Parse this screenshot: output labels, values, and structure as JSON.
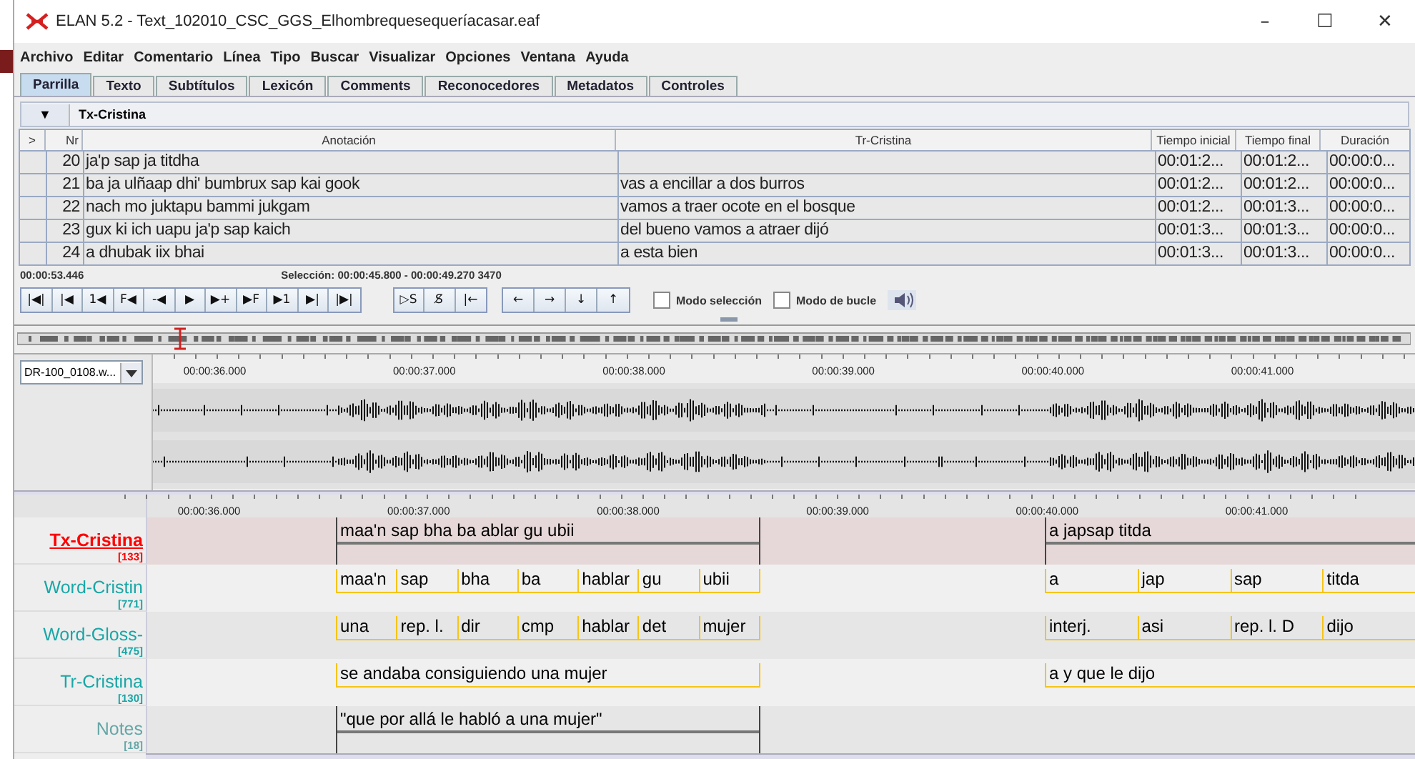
{
  "window": {
    "title": "ELAN 5.2 - Text_102010_CSC_GGS_Elhombrequesequeríacasar.eaf",
    "controls": [
      "–",
      "☐",
      "✕"
    ]
  },
  "menu": [
    "Archivo",
    "Editar",
    "Comentario",
    "Línea",
    "Tipo",
    "Buscar",
    "Visualizar",
    "Opciones",
    "Ventana",
    "Ayuda"
  ],
  "tabs": [
    {
      "label": "Parrilla",
      "selected": true
    },
    {
      "label": "Texto",
      "selected": false
    },
    {
      "label": "Subtítulos",
      "selected": false
    },
    {
      "label": "Lexicón",
      "selected": false
    },
    {
      "label": "Comments",
      "selected": false
    },
    {
      "label": "Reconocedores",
      "selected": false
    },
    {
      "label": "Metadatos",
      "selected": false
    },
    {
      "label": "Controles",
      "selected": false
    }
  ],
  "tier_selector": {
    "button": "▼",
    "tier": "Tx-Cristina"
  },
  "table": {
    "columns": [
      ">",
      "Nr",
      "Anotación",
      "Tr-Cristina",
      "Tiempo inicial",
      "Tiempo final",
      "Duración"
    ],
    "rows": [
      {
        "nr": "20",
        "annotation": "ja'p sap ja titdha",
        "begin": "00:01:2...",
        "end": "00:01:2...",
        "duration": "00:00:0..."
      },
      {
        "nr": "21",
        "annotation": "ba ja ulñaap dhi' bumbrux sap kai gook",
        "translation": "vas a encillar a dos burros",
        "begin": "00:01:2...",
        "end": "00:01:2...",
        "duration": "00:00:0..."
      },
      {
        "nr": "22",
        "annotation": "nach mo juktapu bammi jukgam",
        "translation": "vamos a traer ocote en el bosque",
        "begin": "00:01:2...",
        "end": "00:01:3...",
        "duration": "00:00:0..."
      },
      {
        "nr": "23",
        "annotation": "gux ki ich uapu ja'p sap kaich",
        "translation": "del bueno vamos a atraer dijó",
        "begin": "00:01:3...",
        "end": "00:01:3...",
        "duration": "00:00:0..."
      },
      {
        "nr": "24",
        "annotation": "a dhubak iix bhai",
        "translation": "a esta bien",
        "begin": "00:01:3...",
        "end": "00:01:3...",
        "duration": "00:00:0..."
      }
    ]
  },
  "media": {
    "time": "00:00:53.446",
    "selection": "Selección: 00:00:45.800 - 00:00:49.270  3470",
    "play_buttons": [
      "|◀|",
      "|◀",
      "1◀",
      "F◀",
      "-◀",
      "▶",
      "▶+",
      "▶F",
      "▶1",
      "▶|",
      "|▶|"
    ],
    "selection_buttons": [
      "▷S",
      "S̸",
      "|←"
    ],
    "nav_buttons": [
      "←",
      "→",
      "↓",
      "↑"
    ],
    "options": [
      {
        "label": "Modo selección",
        "checked": false
      },
      {
        "label": "Modo de bucle",
        "checked": false
      }
    ]
  },
  "waveform": {
    "file": "DR-100_0108.w...",
    "ruler": [
      "00:00:36.000",
      "00:00:37.000",
      "00:00:38.000",
      "00:00:39.000",
      "00:00:40.000",
      "00:00:41.000"
    ]
  },
  "timeline": {
    "ruler": [
      "00:00:36.000",
      "00:00:37.000",
      "00:00:38.000",
      "00:00:39.000",
      "00:00:40.000",
      "00:00:41.000"
    ],
    "tiers": [
      {
        "name": "Tx-Cristina",
        "count": "[133]",
        "color": "#ff0000",
        "selected": true,
        "kind": "independent",
        "groups": [
          [
            "maa'n sap bha ba ablar gu ubii"
          ],
          [
            "a japsap titda"
          ]
        ]
      },
      {
        "name": "Word-Cristin",
        "count": "[771]",
        "color": "#1aa6a6",
        "selected": false,
        "kind": "dependent",
        "groups": [
          [
            "maa'n",
            "sap",
            "bha",
            "ba",
            "hablar",
            "gu",
            "ubii"
          ],
          [
            "a",
            "jap",
            "sap",
            "titda"
          ]
        ]
      },
      {
        "name": "Word-Gloss-",
        "count": "[475]",
        "color": "#1aa6a6",
        "selected": false,
        "kind": "dependent",
        "groups": [
          [
            "una",
            "rep. l.",
            "dir",
            "cmp",
            "hablar",
            "det",
            "mujer"
          ],
          [
            "interj.",
            "asi",
            "rep. l. D",
            "dijo"
          ]
        ]
      },
      {
        "name": "Tr-Cristina",
        "count": "[130]",
        "color": "#1aa6a6",
        "selected": false,
        "kind": "dependent",
        "groups": [
          [
            "se andaba consiguiendo una mujer"
          ],
          [
            "a y que le dijo"
          ]
        ]
      },
      {
        "name": "Notes",
        "count": "[18]",
        "color": "#66a6a6",
        "selected": false,
        "kind": "independent",
        "groups": [
          [
            "\"que por allá le habló a una mujer\""
          ]
        ]
      }
    ]
  }
}
